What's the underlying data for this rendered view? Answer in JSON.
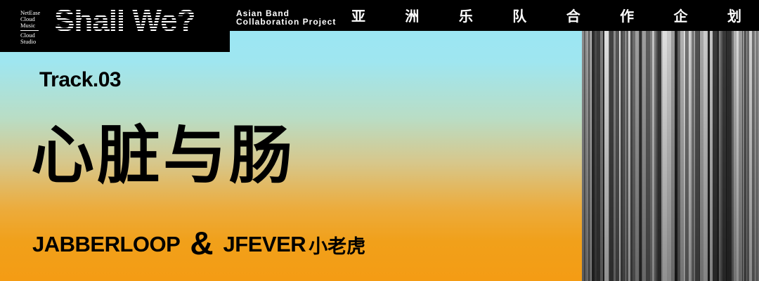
{
  "header": {
    "studio_lines": [
      "NetEase",
      "Cloud",
      "Music",
      "Cloud",
      "Studio"
    ],
    "logo_title": "Shall We?",
    "project_label_line1": "Asian Band",
    "project_label_line2": "Collaboration Project",
    "project_chars": [
      "亚",
      "洲",
      "乐",
      "队",
      "合",
      "作",
      "企",
      "划"
    ]
  },
  "track": {
    "number_label": "Track.03",
    "title": "心脏与肠"
  },
  "artists": {
    "first": "JABBERLOOP",
    "connector": "&",
    "second": "JFEVER",
    "second_cn": "小老虎"
  },
  "colors": {
    "gradient_top": "#98e7f6",
    "gradient_bottom": "#f49c14",
    "bar": "#000000",
    "text_dark": "#000000",
    "text_light": "#ffffff"
  }
}
